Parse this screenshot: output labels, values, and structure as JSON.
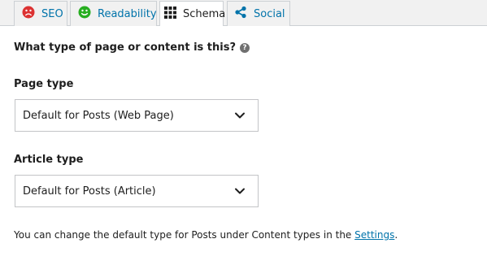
{
  "tabs": [
    {
      "label": "SEO",
      "icon": "sad-face-red-icon",
      "color": "#dc3232"
    },
    {
      "label": "Readability",
      "icon": "happy-face-green-icon",
      "color": "#27ae20"
    },
    {
      "label": "Schema",
      "icon": "grid-icon"
    },
    {
      "label": "Social",
      "icon": "share-icon"
    }
  ],
  "active_tab": "Schema",
  "question": "What type of page or content is this?",
  "page_type": {
    "label": "Page type",
    "value": "Default for Posts (Web Page)"
  },
  "article_type": {
    "label": "Article type",
    "value": "Default for Posts (Article)"
  },
  "note": {
    "text": "You can change the default type for Posts under Content types in the ",
    "link": "Settings",
    "suffix": "."
  },
  "colors": {
    "link": "#0073aa",
    "tab_bg": "#f1f1f1",
    "border": "#ccd0d4"
  }
}
